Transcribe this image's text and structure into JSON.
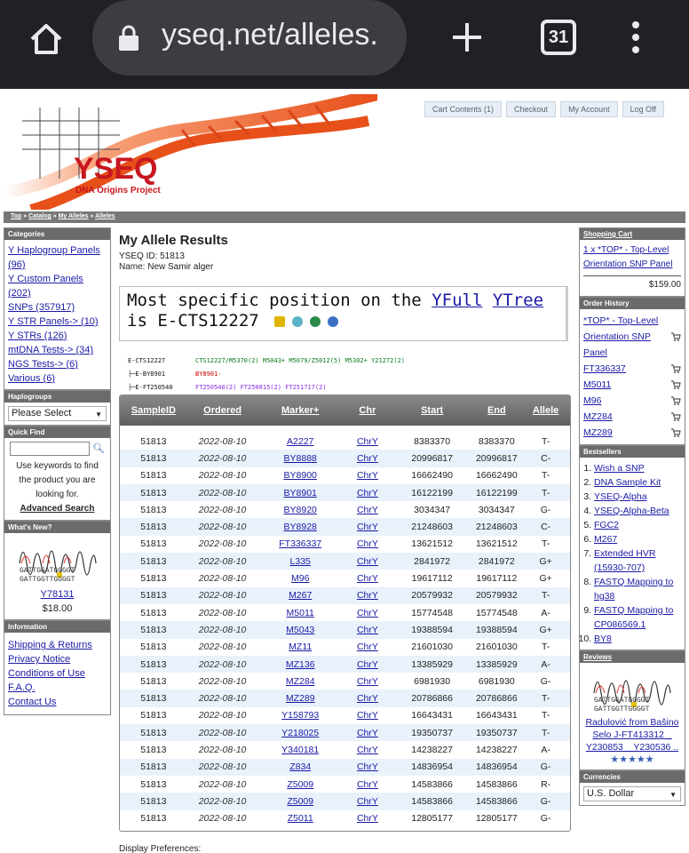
{
  "browser": {
    "url": "yseq.net/alleles.",
    "tab_count": "31"
  },
  "banner": {
    "logo_text": "YSEQ",
    "tagline": "DNA Origins Project",
    "nav": [
      "Cart Contents (1)",
      "Checkout",
      "My Account",
      "Log Off"
    ]
  },
  "breadcrumb": [
    "Top",
    "Catalog",
    "My Alleles",
    "Alleles"
  ],
  "left": {
    "categories_title": "Categories",
    "categories": [
      "Y Haplogroup Panels (96)",
      "Y Custom Panels (202)",
      "SNPs (357917)",
      "Y STR Panels-> (10)",
      "Y STRs (126)",
      "mtDNA Tests-> (34)",
      "NGS Tests-> (6)",
      "Various (6)"
    ],
    "haplogroups_title": "Haplogroups",
    "haplogroups_select": "Please Select",
    "quickfind_title": "Quick Find",
    "quickfind_text": "Use keywords to find the product you are looking for.",
    "advanced_search": "Advanced Search",
    "whatsnew_title": "What's New?",
    "whatsnew_item": "Y78131",
    "whatsnew_price": "$18.00",
    "info_title": "Information",
    "info_links": [
      "Shipping & Returns",
      "Privacy Notice",
      "Conditions of Use",
      "F.A.Q.",
      "Contact Us"
    ]
  },
  "main": {
    "title": "My Allele Results",
    "yseq_id": "YSEQ ID: 51813",
    "name": "Name: New Samir alger",
    "most_prefix": "Most specific position on the",
    "yfull": "YFull",
    "ytree": "YTree",
    "most_is": "is E-CTS12227",
    "tree": [
      {
        "node": "E-CTS12227",
        "snps": "CTS12227/M5370(2)  M5043+ M5079/Z5012(5)  M5302+ Y21272(2)"
      },
      {
        "node": "├─E-BY8901",
        "snps": "BY8901-"
      },
      {
        "node": "├─E-FT250540",
        "snps": "FT250540(2)  FT250815(2)  FT251717(2)"
      }
    ],
    "columns": [
      "SampleID",
      "Ordered",
      "Marker+",
      "Chr",
      "Start",
      "End",
      "Allele"
    ],
    "rows": [
      [
        "51813",
        "2022-08-10",
        "A2227",
        "ChrY",
        "8383370",
        "8383370",
        "T-"
      ],
      [
        "51813",
        "2022-08-10",
        "BY8888",
        "ChrY",
        "20996817",
        "20996817",
        "C-"
      ],
      [
        "51813",
        "2022-08-10",
        "BY8900",
        "ChrY",
        "16662490",
        "16662490",
        "T-"
      ],
      [
        "51813",
        "2022-08-10",
        "BY8901",
        "ChrY",
        "16122199",
        "16122199",
        "T-"
      ],
      [
        "51813",
        "2022-08-10",
        "BY8920",
        "ChrY",
        "3034347",
        "3034347",
        "G-"
      ],
      [
        "51813",
        "2022-08-10",
        "BY8928",
        "ChrY",
        "21248603",
        "21248603",
        "C-"
      ],
      [
        "51813",
        "2022-08-10",
        "FT336337",
        "ChrY",
        "13621512",
        "13621512",
        "T-"
      ],
      [
        "51813",
        "2022-08-10",
        "L335",
        "ChrY",
        "2841972",
        "2841972",
        "G+"
      ],
      [
        "51813",
        "2022-08-10",
        "M96",
        "ChrY",
        "19617112",
        "19617112",
        "G+"
      ],
      [
        "51813",
        "2022-08-10",
        "M267",
        "ChrY",
        "20579932",
        "20579932",
        "T-"
      ],
      [
        "51813",
        "2022-08-10",
        "M5011",
        "ChrY",
        "15774548",
        "15774548",
        "A-"
      ],
      [
        "51813",
        "2022-08-10",
        "M5043",
        "ChrY",
        "19388594",
        "19388594",
        "G+"
      ],
      [
        "51813",
        "2022-08-10",
        "MZ11",
        "ChrY",
        "21601030",
        "21601030",
        "T-"
      ],
      [
        "51813",
        "2022-08-10",
        "MZ136",
        "ChrY",
        "13385929",
        "13385929",
        "A-"
      ],
      [
        "51813",
        "2022-08-10",
        "MZ284",
        "ChrY",
        "6981930",
        "6981930",
        "G-"
      ],
      [
        "51813",
        "2022-08-10",
        "MZ289",
        "ChrY",
        "20786866",
        "20786866",
        "T-"
      ],
      [
        "51813",
        "2022-08-10",
        "Y158793",
        "ChrY",
        "16643431",
        "16643431",
        "T-"
      ],
      [
        "51813",
        "2022-08-10",
        "Y218025",
        "ChrY",
        "19350737",
        "19350737",
        "T-"
      ],
      [
        "51813",
        "2022-08-10",
        "Y340181",
        "ChrY",
        "14238227",
        "14238227",
        "A-"
      ],
      [
        "51813",
        "2022-08-10",
        "Z834",
        "ChrY",
        "14836954",
        "14836954",
        "G-"
      ],
      [
        "51813",
        "2022-08-10",
        "Z5009",
        "ChrY",
        "14583866",
        "14583866",
        "R-"
      ],
      [
        "51813",
        "2022-08-10",
        "Z5009",
        "ChrY",
        "14583866",
        "14583866",
        "G-"
      ],
      [
        "51813",
        "2022-08-10",
        "Z5011",
        "ChrY",
        "12805177",
        "12805177",
        "G-"
      ]
    ],
    "display_prefs": "Display Preferences:"
  },
  "right": {
    "cart_title": "Shopping Cart",
    "cart_item": "1 x *TOP* - Top-Level Orientation SNP Panel",
    "cart_total": "$159.00",
    "history_title": "Order History",
    "history": [
      "*TOP* - Top-Level Orientation SNP Panel",
      "FT336337",
      "M5011",
      "M96",
      "MZ284",
      "MZ289"
    ],
    "bestsellers_title": "Bestsellers",
    "bestsellers": [
      "Wish a SNP",
      "DNA Sample Kit",
      "YSEQ-Alpha",
      "YSEQ-Alpha-Beta",
      "FGC2",
      "M267",
      "Extended HVR (15930-707)",
      "FASTQ Mapping to hg38",
      "FASTQ Mapping to CP086569.1",
      "BY8"
    ],
    "reviews_title": "Reviews",
    "review_text": "Radulović from Bašino Selo J-FT413312 _ Y230853 _ Y230536 ..",
    "review_stars": "★★★★★",
    "currencies_title": "Currencies",
    "currency": "U.S. Dollar"
  },
  "colors": {
    "chrome": "#202124",
    "urlbar": "#3c3d40",
    "header_gray": "#6b6b6b",
    "link": "#1a1aa6",
    "row_alt": "#e9f2fb",
    "helix": "#e8501a"
  }
}
